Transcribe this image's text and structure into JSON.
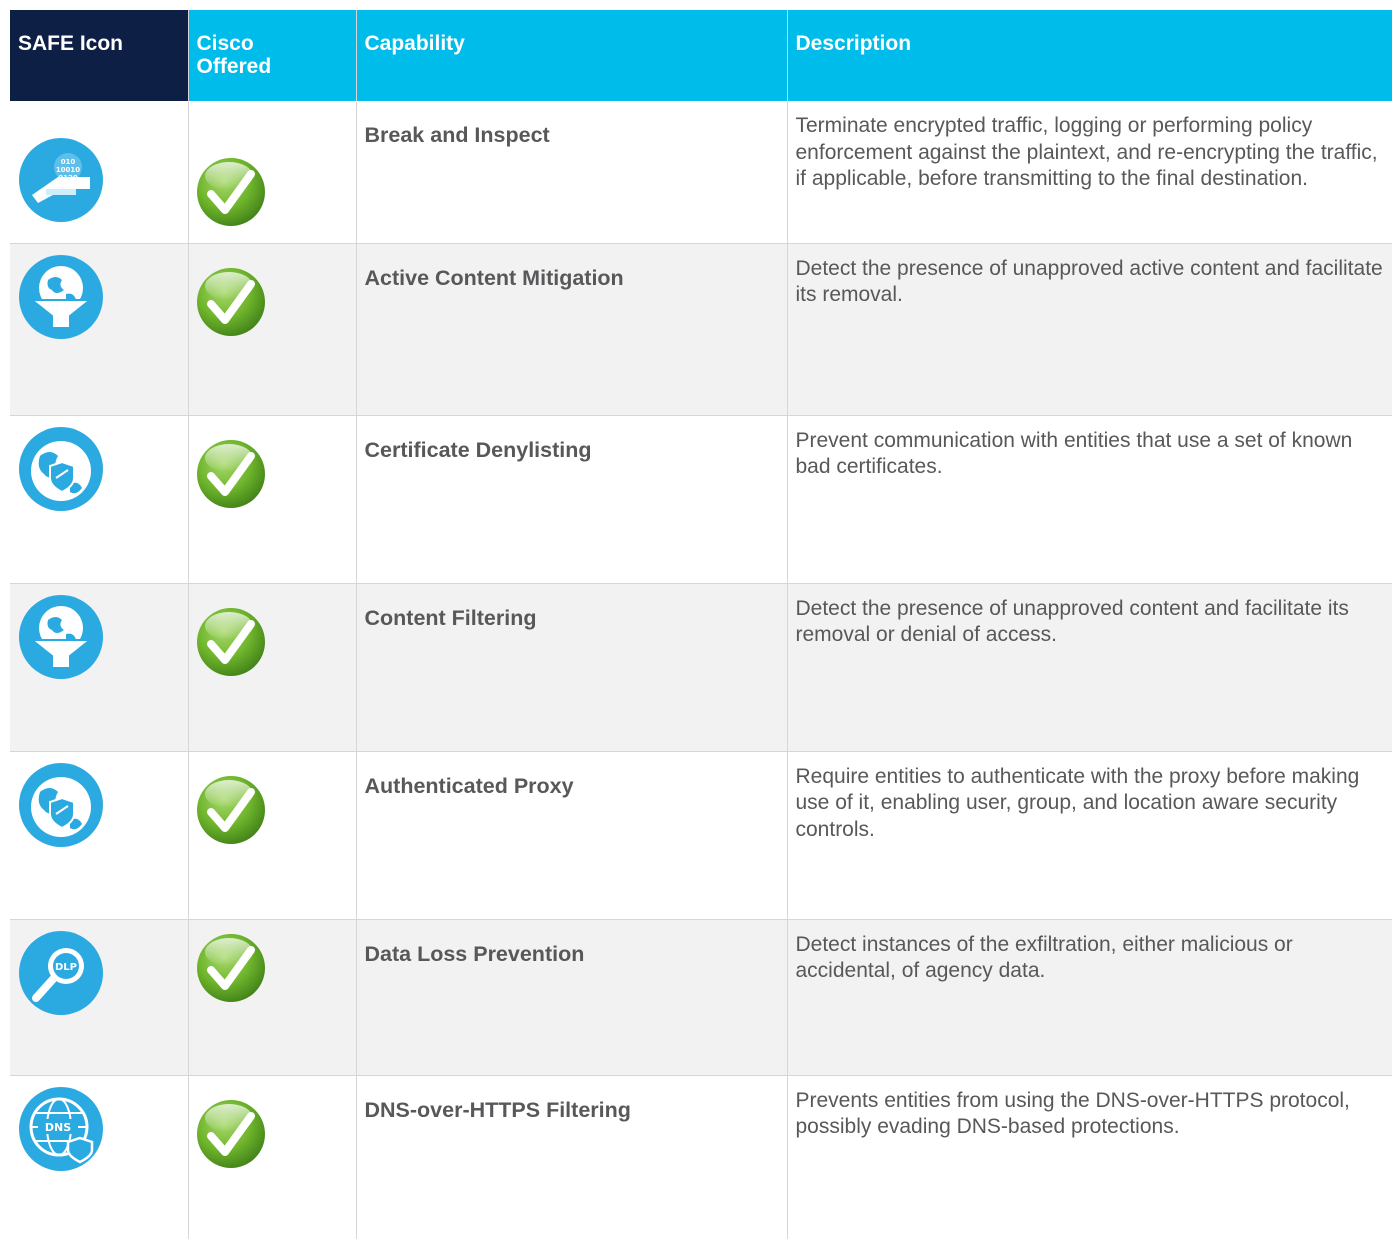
{
  "headers": {
    "safe_icon": "SAFE Icon",
    "cisco_offered": "Cisco Offered",
    "capability": "Capability",
    "description": "Description"
  },
  "colors": {
    "header_navy": "#0d1f45",
    "header_cyan": "#00bceb",
    "icon_blue": "#2baae1",
    "check_green": "#6fb52c",
    "text_gray": "#58585b",
    "row_alt": "#f2f2f2"
  },
  "rows": [
    {
      "icon": "encrypted-traffic-icon",
      "icon_text": "010 10010 0120",
      "offered": "check-icon",
      "capability": "Break and Inspect",
      "description": "Terminate encrypted traffic, logging or performing policy enforcement against the plaintext, and re-encrypting the traffic, if applicable, before transmitting to the final destination."
    },
    {
      "icon": "globe-filter-icon",
      "offered": "check-icon",
      "capability": "Active Content Mitigation",
      "description": "Detect the presence of unapproved active content and facilitate its removal."
    },
    {
      "icon": "globe-shield-icon",
      "offered": "check-icon",
      "capability": "Certificate Denylisting",
      "description": "Prevent communication with entities that use a set of known bad certificates."
    },
    {
      "icon": "globe-filter-icon",
      "offered": "check-icon",
      "capability": "Content Filtering",
      "description": "Detect the presence of unapproved content and facilitate its removal or denial of access."
    },
    {
      "icon": "globe-shield-icon",
      "offered": "check-icon",
      "capability": "Authenticated Proxy",
      "description": "Require entities to authenticate with the proxy before making use of it, enabling user, group, and location aware security controls."
    },
    {
      "icon": "dlp-magnifier-icon",
      "icon_text": "DLP",
      "offered": "check-icon",
      "capability": "Data Loss Prevention",
      "description": "Detect instances of the exfiltration, either malicious or accidental, of agency data."
    },
    {
      "icon": "dns-globe-shield-icon",
      "icon_text": "DNS",
      "offered": "check-icon",
      "capability": "DNS-over-HTTPS Filtering",
      "description": "Prevents entities from using the DNS-over-HTTPS protocol, possibly evading DNS-based protections."
    }
  ]
}
